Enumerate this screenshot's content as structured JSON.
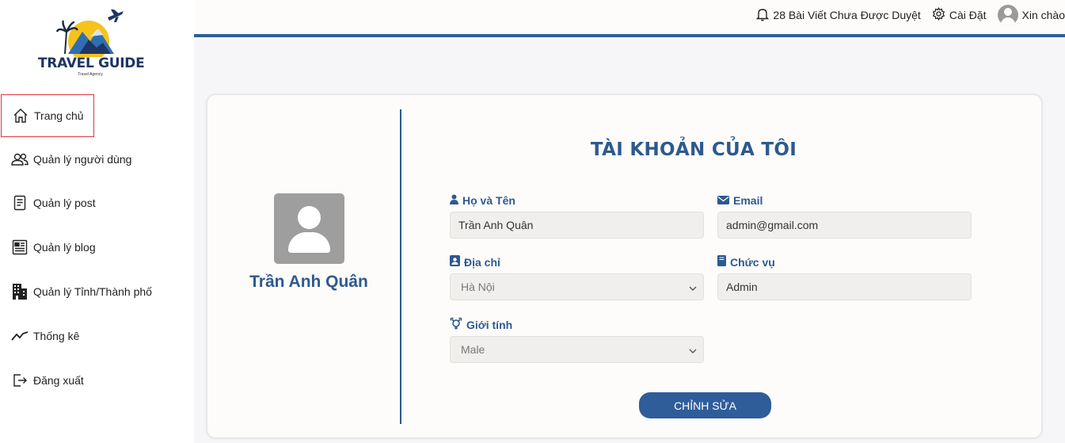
{
  "logo": {
    "title": "TRAVEL GUIDE",
    "subtitle": "Travel Agency"
  },
  "sidebar": {
    "items": [
      {
        "label": "Trang chủ",
        "icon": "home-icon",
        "active": true
      },
      {
        "label": "Quản lý người dùng",
        "icon": "users-icon"
      },
      {
        "label": "Quản lý post",
        "icon": "document-icon"
      },
      {
        "label": "Quản lý blog",
        "icon": "newspaper-icon"
      },
      {
        "label": "Quản lý Tỉnh/Thành phố",
        "icon": "buildings-icon"
      },
      {
        "label": "Thống kê",
        "icon": "chart-line-icon"
      },
      {
        "label": "Đăng xuất",
        "icon": "logout-icon"
      }
    ]
  },
  "topbar": {
    "notifications": "28 Bài Viết Chưa Được Duyệt",
    "settings": "Cài Đặt",
    "greeting": "Xin chào"
  },
  "profile": {
    "name": "Trần Anh Quân",
    "title": "TÀI KHOẢN CỦA TÔI",
    "fields": {
      "fullname": {
        "label": "Họ và Tên",
        "value": "Trần Anh Quân"
      },
      "email": {
        "label": "Email",
        "value": "admin@gmail.com"
      },
      "address": {
        "label": "Địa chỉ",
        "value": "Hà Nội"
      },
      "role": {
        "label": "Chức vụ",
        "value": "Admin"
      },
      "gender": {
        "label": "Giới tính",
        "value": "Male"
      }
    },
    "edit_label": "CHỈNH SỬA"
  },
  "colors": {
    "accent": "#2f5d9a",
    "brand_dark": "#1f3564",
    "active_border": "#e0373c"
  }
}
